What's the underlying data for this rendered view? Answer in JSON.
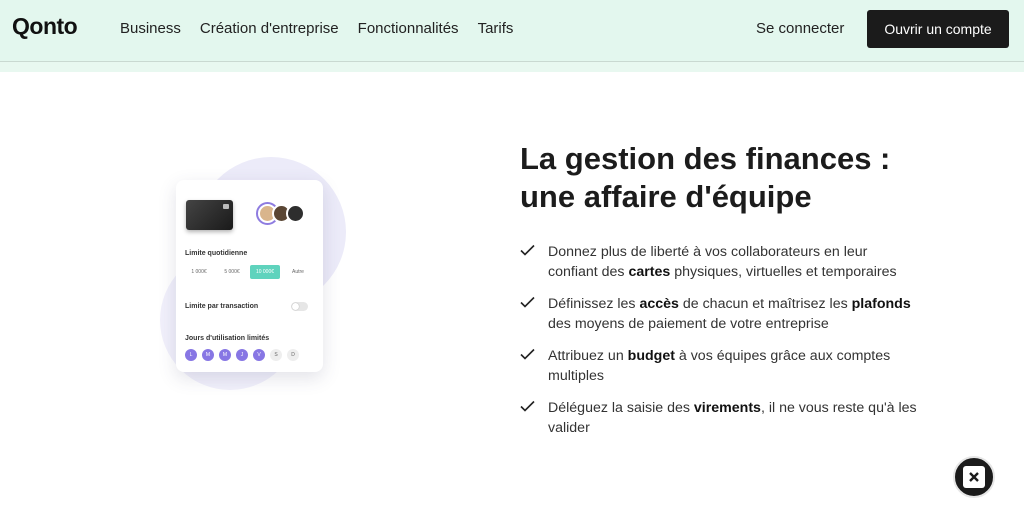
{
  "header": {
    "logo": "Qonto",
    "nav": [
      "Business",
      "Création d'entreprise",
      "Fonctionnalités",
      "Tarifs"
    ],
    "login_label": "Se connecter",
    "cta_label": "Ouvrir un compte"
  },
  "illustration": {
    "daily_limit_label": "Limite quotidienne",
    "limit_options": [
      "1 000€",
      "5 000€",
      "10 000€",
      "Autre"
    ],
    "limit_selected": "10 000€",
    "per_transaction_label": "Limite par transaction",
    "usage_days_label": "Jours d'utilisation limités",
    "days": [
      "L",
      "M",
      "M",
      "J",
      "V",
      "S",
      "D"
    ],
    "days_active": [
      true,
      true,
      true,
      true,
      true,
      false,
      false
    ]
  },
  "main": {
    "title_line1": "La gestion des finances :",
    "title_line2": "une affaire d'équipe",
    "features": [
      {
        "pre": "Donnez plus de liberté à vos collaborateurs en leur confiant des ",
        "bold": "cartes",
        "post": " physiques, virtuelles et temporaires"
      },
      {
        "pre": "Définissez les ",
        "bold": "accès",
        "mid": " de chacun et maîtrisez les ",
        "bold2": "plafonds",
        "post": " des moyens de paiement de votre entreprise"
      },
      {
        "pre": "Attribuez un ",
        "bold": "budget",
        "post": " à vos équipes grâce aux comptes multiples"
      },
      {
        "pre": "Déléguez la saisie des ",
        "bold": "virements",
        "post": ", il ne vous reste qu'à les valider"
      }
    ]
  },
  "colors": {
    "header_bg": "#e3f7ee",
    "cta_bg": "#1b1b1b",
    "accent_purple": "#8776e4",
    "accent_teal": "#5fd3bd"
  },
  "icons": {
    "check": "check-icon",
    "widget": "chat-widget-icon"
  }
}
